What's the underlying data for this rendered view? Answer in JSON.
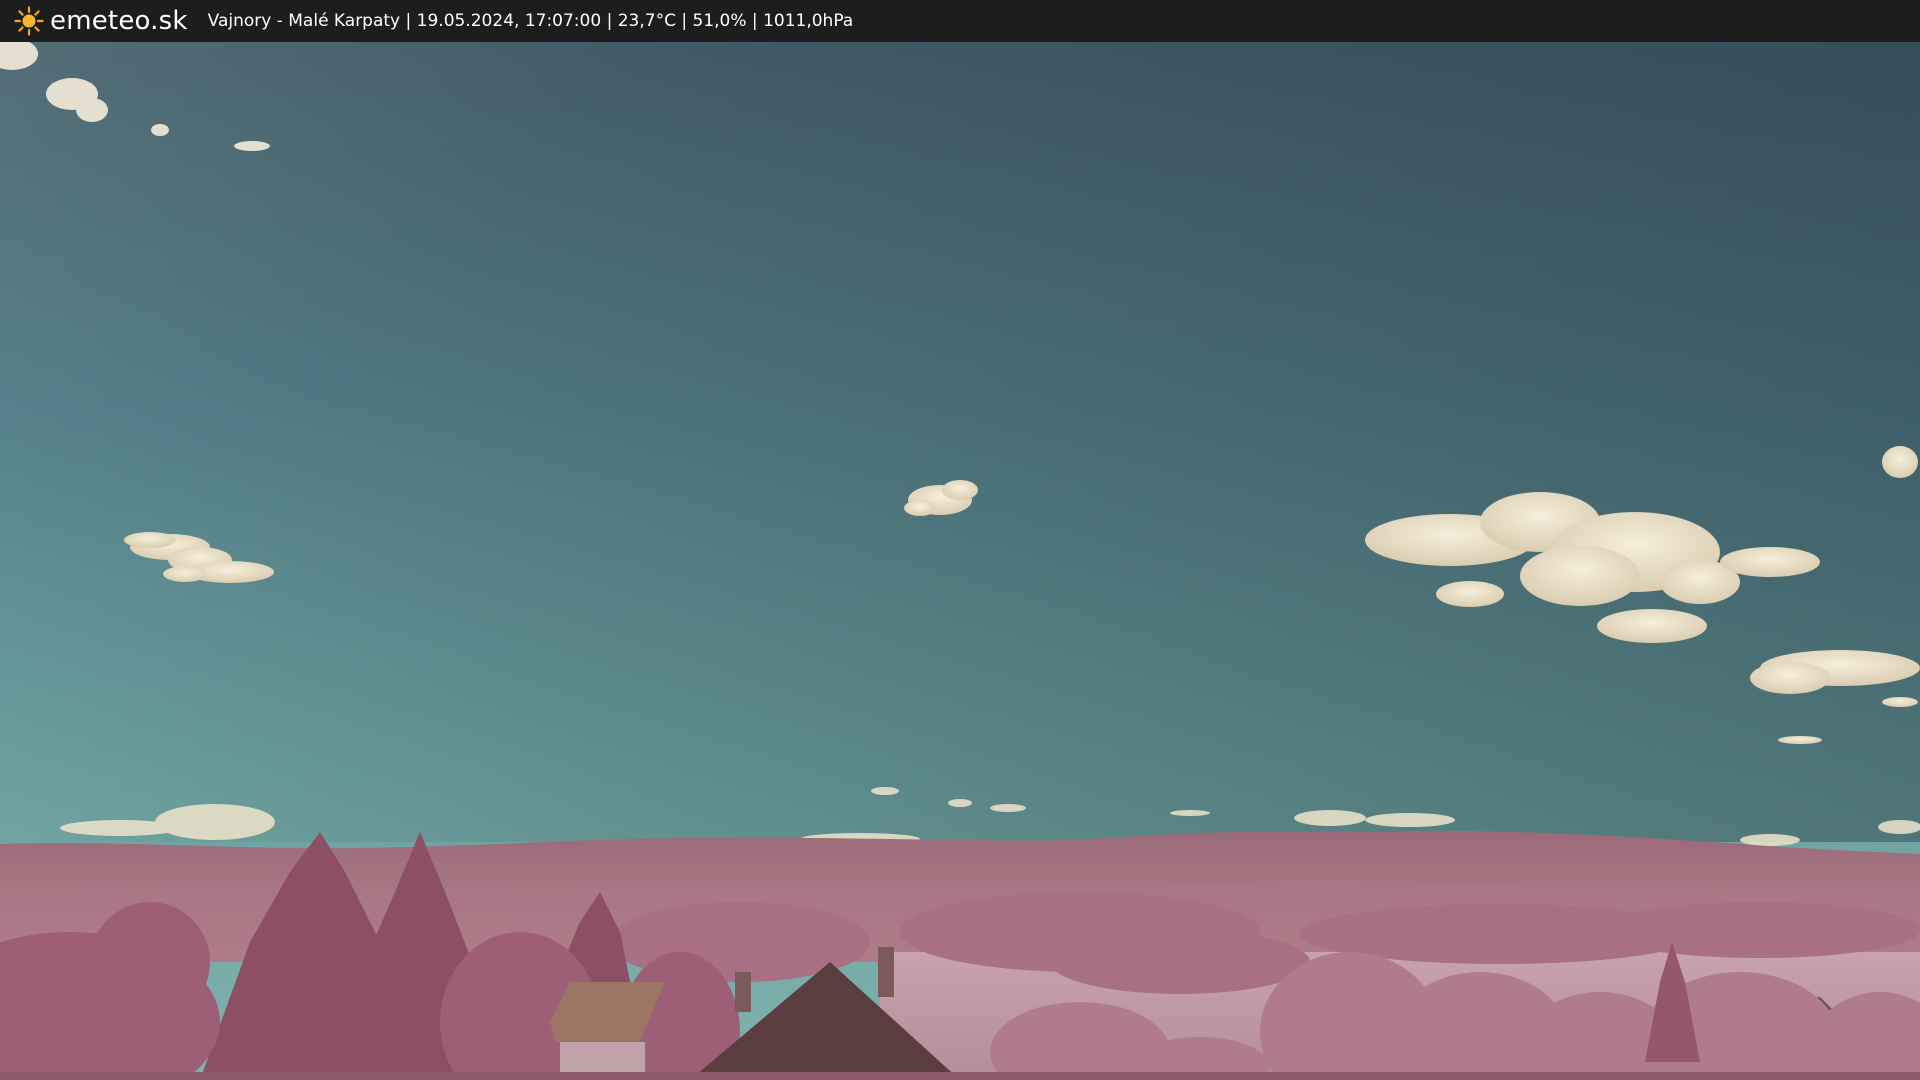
{
  "header": {
    "brand": "emeteo.sk",
    "location": "Vajnory - Malé Karpaty",
    "datetime": "19.05.2024, 17:07:00",
    "temperature": "23,7°C",
    "humidity": "51,0%",
    "pressure": "1011,0hPa",
    "separator": " | "
  },
  "icons": {
    "logo": "sun-icon"
  },
  "colors": {
    "header_bg": "#1d1d1d",
    "sun_color": "#f5a623",
    "sky_top": "#3f5a68",
    "sky_horizon": "#73a7a6",
    "vegetation": "#b97c8e"
  }
}
